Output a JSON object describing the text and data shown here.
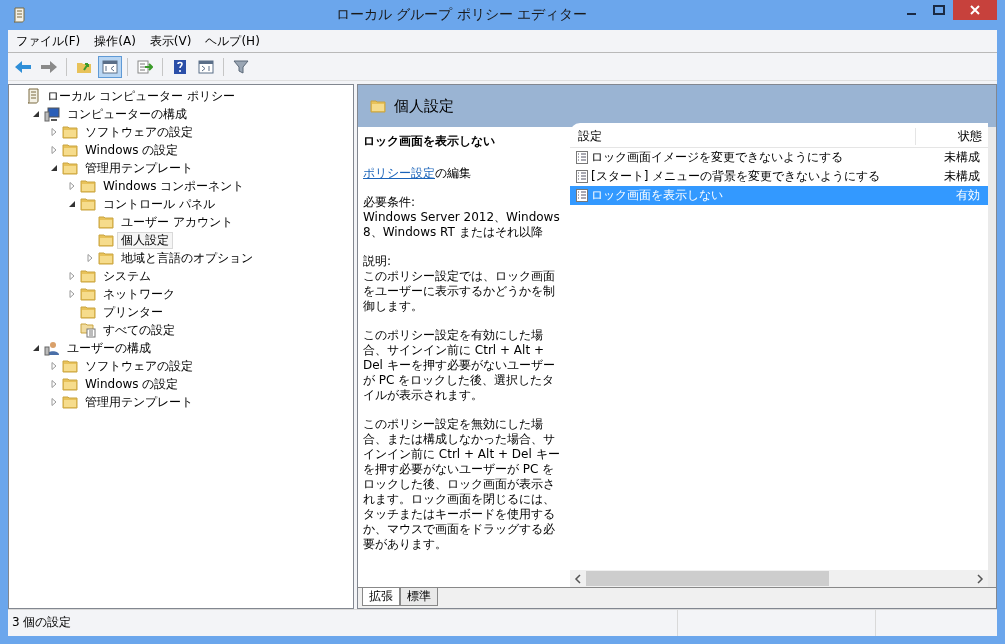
{
  "window": {
    "title": "ローカル グループ ポリシー エディター"
  },
  "menu": [
    "ファイル(F)",
    "操作(A)",
    "表示(V)",
    "ヘルプ(H)"
  ],
  "toolbar": [
    [
      {
        "kind": "back",
        "selected": false
      },
      {
        "kind": "forward",
        "selected": false
      }
    ],
    [
      {
        "kind": "up",
        "selected": false
      },
      {
        "kind": "tree",
        "selected": true
      }
    ],
    [
      {
        "kind": "export",
        "selected": false
      }
    ],
    [
      {
        "kind": "help",
        "selected": false
      },
      {
        "kind": "pane",
        "selected": false
      }
    ],
    [
      {
        "kind": "filter",
        "selected": false
      }
    ]
  ],
  "tree": [
    {
      "label": "ローカル コンピューター ポリシー",
      "kind": "policy",
      "selected": false,
      "children": [
        {
          "label": "コンピューターの構成",
          "kind": "computer",
          "selected": false,
          "expanded": true,
          "children": [
            {
              "label": "ソフトウェアの設定",
              "kind": "folder",
              "selected": false,
              "expanded": false
            },
            {
              "label": "Windows の設定",
              "kind": "folder",
              "selected": false,
              "expanded": false
            },
            {
              "label": "管理用テンプレート",
              "kind": "folder",
              "selected": false,
              "expanded": true,
              "children": [
                {
                  "label": "Windows コンポーネント",
                  "kind": "folder",
                  "selected": false,
                  "expanded": false
                },
                {
                  "label": "コントロール パネル",
                  "kind": "folder",
                  "selected": false,
                  "expanded": true,
                  "children": [
                    {
                      "label": "ユーザー アカウント",
                      "kind": "folder",
                      "selected": false
                    },
                    {
                      "label": "個人設定",
                      "kind": "folder",
                      "selected": true
                    },
                    {
                      "label": "地域と言語のオプション",
                      "kind": "folder",
                      "selected": false,
                      "expanded": false
                    }
                  ]
                },
                {
                  "label": "システム",
                  "kind": "folder",
                  "selected": false,
                  "expanded": false
                },
                {
                  "label": "ネットワーク",
                  "kind": "folder",
                  "selected": false,
                  "expanded": false
                },
                {
                  "label": "プリンター",
                  "kind": "folder",
                  "selected": false
                },
                {
                  "label": "すべての設定",
                  "kind": "settings",
                  "selected": false
                }
              ]
            }
          ]
        },
        {
          "label": "ユーザーの構成",
          "kind": "user",
          "selected": false,
          "expanded": true,
          "children": [
            {
              "label": "ソフトウェアの設定",
              "kind": "folder",
              "selected": false,
              "expanded": false
            },
            {
              "label": "Windows の設定",
              "kind": "folder",
              "selected": false,
              "expanded": false
            },
            {
              "label": "管理用テンプレート",
              "kind": "folder",
              "selected": false,
              "expanded": false
            }
          ]
        }
      ]
    }
  ],
  "header": {
    "title": "個人設定"
  },
  "description": {
    "title": "ロック画面を表示しない",
    "link": "ポリシー設定",
    "link_suffix": "の編集",
    "paragraphs": [
      "必要条件:\nWindows Server 2012、Windows 8、Windows RT またはそれ以降",
      "説明:\nこのポリシー設定では、ロック画面をユーザーに表示するかどうかを制御します。",
      "このポリシー設定を有効にした場合、サインイン前に Ctrl + Alt + Del キーを押す必要がないユーザーが PC をロックした後、選択したタイルが表示されます。",
      "このポリシー設定を無効にした場合、または構成しなかった場合、サインイン前に Ctrl + Alt + Del キーを押す必要がないユーザーが PC をロックした後、ロック画面が表示されます。ロック画面を閉じるには、タッチまたはキーボードを使用するか、マウスで画面をドラッグする必要があります。"
    ]
  },
  "table": {
    "columns": [
      "設定",
      "状態"
    ],
    "rows": [
      {
        "setting": "ロック画面イメージを変更できないようにする",
        "state": "未構成",
        "selected": false
      },
      {
        "setting": "[スタート] メニューの背景を変更できないようにする",
        "state": "未構成",
        "selected": false
      },
      {
        "setting": "ロック画面を表示しない",
        "state": "有効",
        "selected": true
      }
    ]
  },
  "tabs": [
    {
      "label": "拡張",
      "selected": true
    },
    {
      "label": "標準",
      "selected": false
    }
  ],
  "status_bar": "3 個の設定"
}
